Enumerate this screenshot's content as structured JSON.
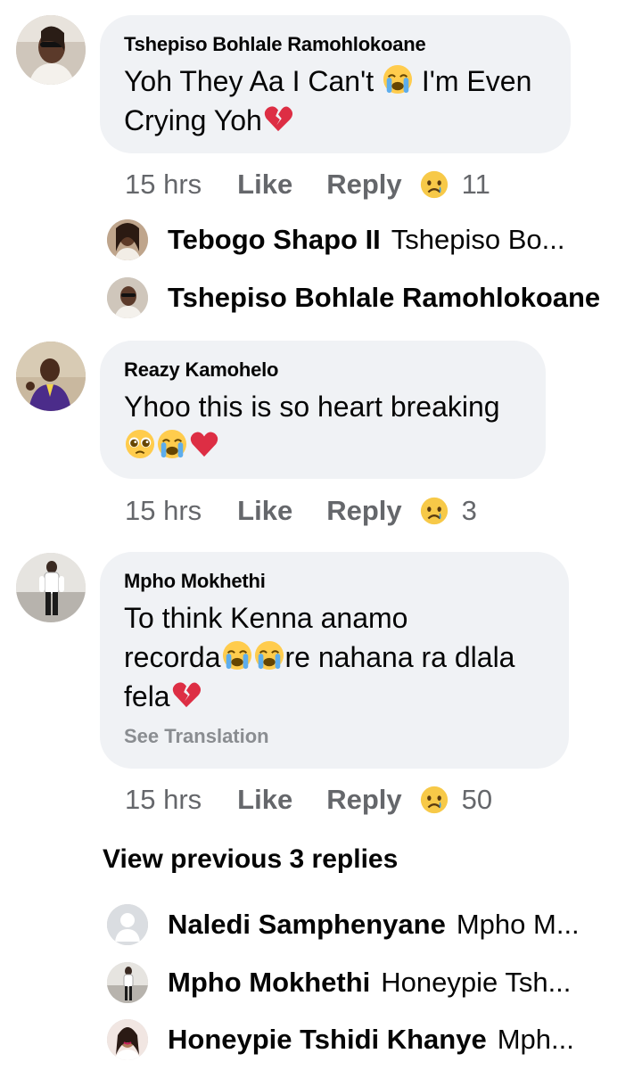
{
  "comments": [
    {
      "author": "Tshepiso Bohlale Ramohlokoane",
      "text_line1_a": "Yoh They Aa I Can't",
      "text_line1_b": "I'm Even",
      "text_line2": "Crying Yoh",
      "time": "15 hrs",
      "like_label": "Like",
      "reply_label": "Reply",
      "reaction_count": "11",
      "reaction_icon": "sad-face-icon"
    },
    {
      "author": "Reazy Kamohelo",
      "text_line1": "Yhoo this is so heart breaking",
      "time": "15 hrs",
      "like_label": "Like",
      "reply_label": "Reply",
      "reaction_count": "3",
      "reaction_icon": "sad-face-icon"
    },
    {
      "author": "Mpho Mokhethi",
      "text_line1": "To think Kenna anamo",
      "text_line2_a": "recorda",
      "text_line2_b": "re nahana ra dlala",
      "text_line3": "fela",
      "see_translation": "See Translation",
      "time": "15 hrs",
      "like_label": "Like",
      "reply_label": "Reply",
      "reaction_count": "50",
      "reaction_icon": "sad-face-icon"
    }
  ],
  "replies_group1": [
    {
      "name": "Tebogo Shapo II",
      "snippet": "Tshepiso Bo..."
    },
    {
      "name": "Tshepiso Bohlale Ramohlokoane",
      "snippet": ""
    }
  ],
  "view_previous": "View previous 3 replies",
  "replies_group2": [
    {
      "name": "Naledi Samphenyane",
      "snippet": "Mpho M..."
    },
    {
      "name": "Mpho Mokhethi",
      "snippet": "Honeypie Tsh..."
    },
    {
      "name": "Honeypie Tshidi Khanye",
      "snippet": "Mph..."
    }
  ],
  "colors": {
    "bubble": "#f0f2f5",
    "meta_text": "#65676b",
    "text": "#050505",
    "translation": "#8a8d91"
  }
}
